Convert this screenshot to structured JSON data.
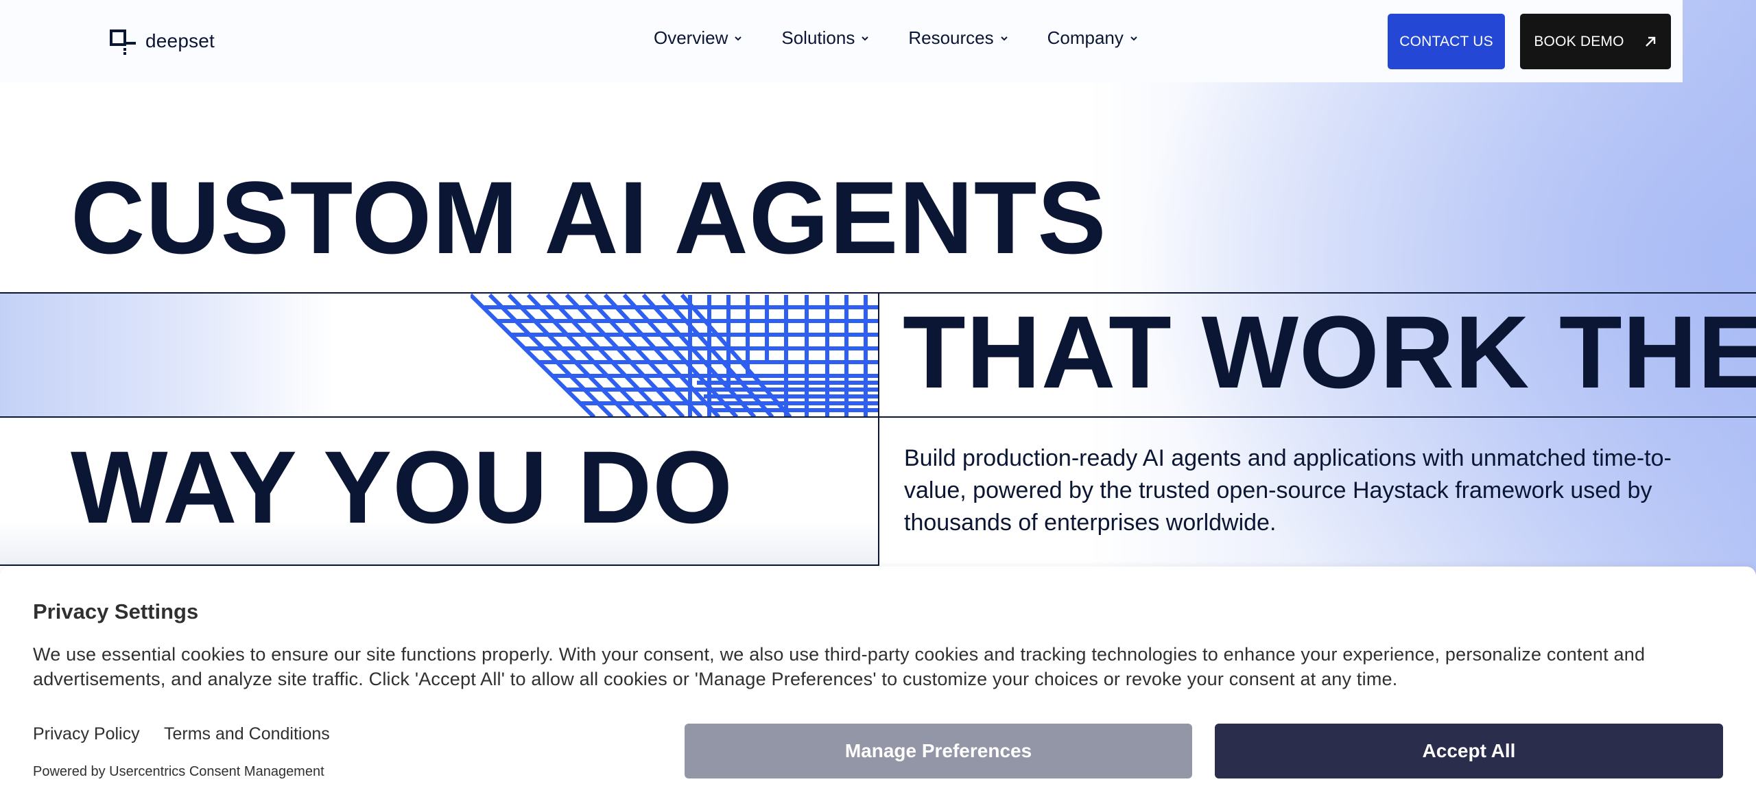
{
  "header": {
    "logo_text": "deepset",
    "nav": [
      {
        "label": "Overview"
      },
      {
        "label": "Solutions"
      },
      {
        "label": "Resources"
      },
      {
        "label": "Company"
      }
    ],
    "contact_label": "CONTACT US",
    "demo_label": "BOOK DEMO"
  },
  "hero": {
    "line1": "CUSTOM AI AGENTS",
    "line2": "THAT WORK THE",
    "line3": "WAY YOU DO",
    "subtitle": "Build production-ready AI agents and applications with unmatched time-to-value, powered by the trusted open-source Haystack framework used by thousands of enterprises worldwide."
  },
  "cookie": {
    "title": "Privacy Settings",
    "text": "We use essential cookies to ensure our site functions properly. With your consent, we also use third-party cookies and tracking technologies to enhance your experience, personalize content and advertisements, and analyze site traffic. Click 'Accept All' to allow all cookies or 'Manage Preferences' to customize your choices or revoke your consent at any time.",
    "privacy_link": "Privacy Policy",
    "terms_link": "Terms and Conditions",
    "powered_by": "Powered by Usercentrics Consent Management",
    "manage_label": "Manage Preferences",
    "accept_label": "Accept All"
  },
  "colors": {
    "brand_navy": "#0b1634",
    "contact_blue": "#2447d6",
    "demo_black": "#141414",
    "accent_blue_grid": "#2f5ff0",
    "manage_gray": "#9396a6",
    "accept_navy": "#2b2d4d"
  },
  "icons": {
    "logo": "deepset-logo-icon",
    "chevron": "chevron-down-icon",
    "arrow": "arrow-up-right-icon"
  }
}
